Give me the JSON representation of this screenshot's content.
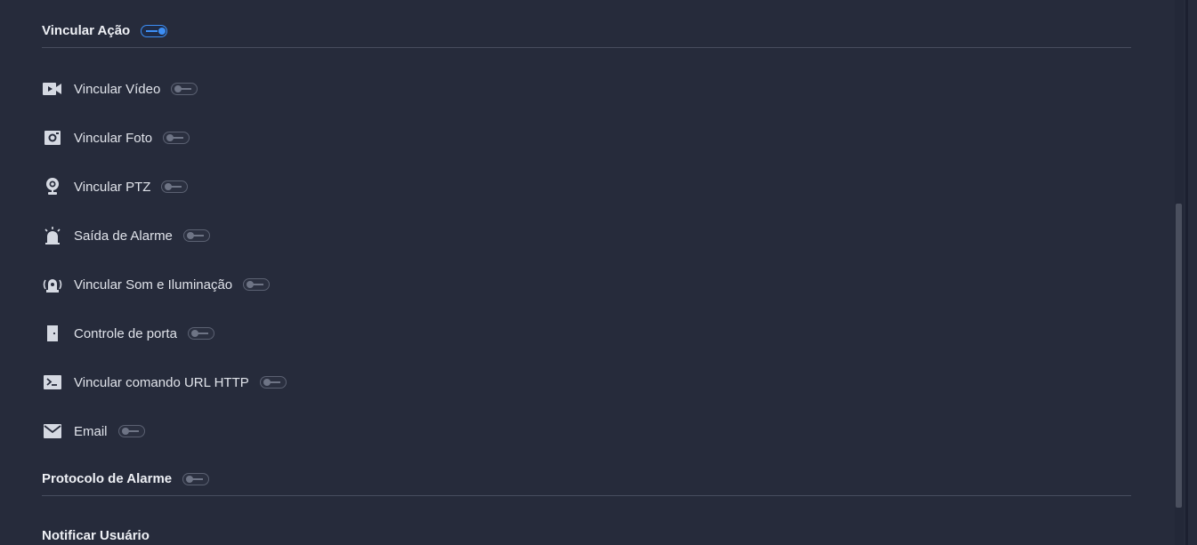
{
  "link_action": {
    "title": "Vincular Ação",
    "enabled": true,
    "items": [
      {
        "icon": "video-camera-icon",
        "label": "Vincular Vídeo",
        "enabled": false
      },
      {
        "icon": "camera-photo-icon",
        "label": "Vincular Foto",
        "enabled": false
      },
      {
        "icon": "ptz-camera-icon",
        "label": "Vincular PTZ",
        "enabled": false
      },
      {
        "icon": "alarm-siren-icon",
        "label": "Saída de Alarme",
        "enabled": false
      },
      {
        "icon": "sound-light-icon",
        "label": "Vincular Som e Iluminação",
        "enabled": false
      },
      {
        "icon": "door-icon",
        "label": "Controle de porta",
        "enabled": false
      },
      {
        "icon": "terminal-icon",
        "label": "Vincular comando URL HTTP",
        "enabled": false
      },
      {
        "icon": "envelope-icon",
        "label": "Email",
        "enabled": false
      }
    ]
  },
  "alarm_protocol": {
    "title": "Protocolo de Alarme",
    "enabled": false
  },
  "notify_user": {
    "title": "Notificar Usuário"
  },
  "colors": {
    "background": "#262b3b",
    "accent": "#3d8ff5",
    "toggle_off": "#6e7485"
  }
}
